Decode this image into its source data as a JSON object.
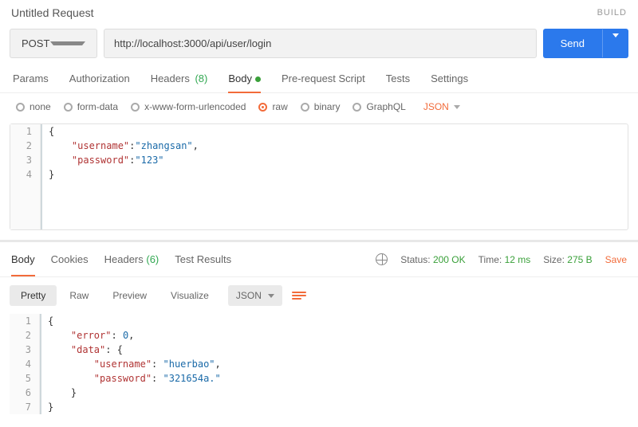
{
  "header": {
    "title": "Untitled Request",
    "build": "BUILD"
  },
  "request": {
    "method": "POST",
    "url": "http://localhost:3000/api/user/login",
    "send": "Send"
  },
  "tabs": {
    "params": "Params",
    "authorization": "Authorization",
    "headers_label": "Headers",
    "headers_count": "(8)",
    "body": "Body",
    "pre_request": "Pre-request Script",
    "tests": "Tests",
    "settings": "Settings"
  },
  "body_types": {
    "none": "none",
    "form_data": "form-data",
    "urlencoded": "x-www-form-urlencoded",
    "raw": "raw",
    "binary": "binary",
    "graphql": "GraphQL",
    "subtype": "JSON"
  },
  "request_body": {
    "lines": [
      "1",
      "2",
      "3",
      "4"
    ],
    "l1": "{",
    "indent2": "    ",
    "k_user": "\"username\"",
    "v_user": "\"zhangsan\"",
    "comma": ",",
    "indent3": "    ",
    "k_pass": "\"password\"",
    "v_pass": "\"123\"",
    "l4": "}"
  },
  "response": {
    "tabs": {
      "body": "Body",
      "cookies": "Cookies",
      "headers_label": "Headers",
      "headers_count": "(6)",
      "test_results": "Test Results"
    },
    "meta": {
      "status_label": "Status:",
      "status_value": "200 OK",
      "time_label": "Time:",
      "time_value": "12 ms",
      "size_label": "Size:",
      "size_value": "275 B",
      "save": "Save"
    },
    "views": {
      "pretty": "Pretty",
      "raw": "Raw",
      "preview": "Preview",
      "visualize": "Visualize",
      "type": "JSON"
    },
    "body": {
      "lines": [
        "1",
        "2",
        "3",
        "4",
        "5",
        "6",
        "7"
      ],
      "l1": "{",
      "i2": "    ",
      "k_error": "\"error\"",
      "v_error": "0",
      "c": ",",
      "i3": "    ",
      "k_data": "\"data\"",
      "brace_open": "{",
      "i4": "        ",
      "k_user": "\"username\"",
      "v_user": "\"huerbao\"",
      "i5": "        ",
      "k_pass": "\"password\"",
      "v_pass": "\"321654a.\"",
      "i6": "    ",
      "brace_close": "}",
      "l7": "}"
    }
  }
}
